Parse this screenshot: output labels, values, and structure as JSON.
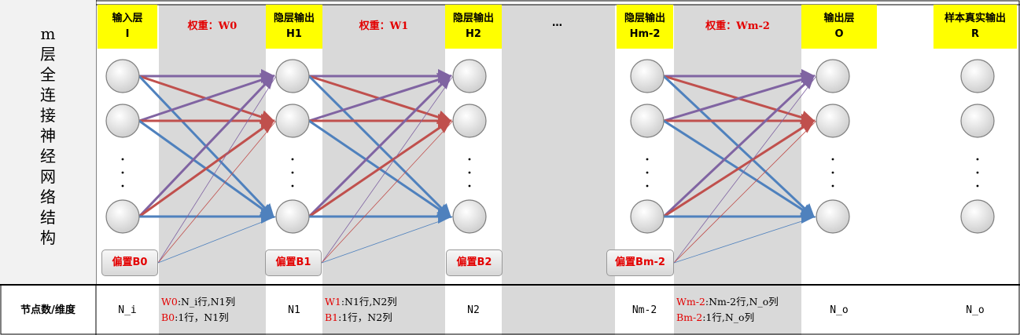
{
  "side_title": "m层全连接神经网络结构",
  "headers": [
    {
      "id": "input",
      "line1": "输入层",
      "line2": "I"
    },
    {
      "id": "h1",
      "line1": "隐层输出",
      "line2": "H1"
    },
    {
      "id": "h2",
      "line1": "隐层输出",
      "line2": "H2"
    },
    {
      "id": "hm2",
      "line1": "隐层输出",
      "line2": "Hm-2"
    },
    {
      "id": "output",
      "line1": "输出层",
      "line2": "O"
    },
    {
      "id": "real",
      "line1": "样本真实输出",
      "line2": "R"
    }
  ],
  "weights": [
    {
      "id": "w0",
      "label": "权重：W0"
    },
    {
      "id": "w1",
      "label": "权重：W1"
    },
    {
      "id": "wm2",
      "label": "权重：Wm-2"
    }
  ],
  "ellipsis": "…",
  "biases": [
    {
      "id": "b0",
      "label": "偏置B0"
    },
    {
      "id": "b1",
      "label": "偏置B1"
    },
    {
      "id": "b2",
      "label": "偏置B2"
    },
    {
      "id": "bm2",
      "label": "偏置Bm-2"
    }
  ],
  "bottom": {
    "row_label": "节点数/维度",
    "n_i": "N_i",
    "w0_line1_red": "W0",
    "w0_line1": ":N_i行,N1列",
    "w0_line2_red": "B0",
    "w0_line2": ":1行，N1列",
    "n1": "N1",
    "w1_line1_red": "W1",
    "w1_line1": ":N1行,N2列",
    "w1_line2_red": "B1",
    "w1_line2": ":1行，N2列",
    "n2": "N2",
    "nm2": "Nm-2",
    "wm2_line1_red": "Wm-2",
    "wm2_line1": ":Nm-2行,N_o列",
    "wm2_line2_red": "Bm-2",
    "wm2_line2": ":1行,N_o列",
    "n_o": "N_o",
    "n_o2": "N_o"
  },
  "colors": {
    "header_bg": "#ffff00",
    "weight_band": "#d9d9d9",
    "red_text": "#e30000",
    "arrow_purple": "#8064a2",
    "arrow_red": "#c0504d",
    "arrow_blue": "#4f81bd"
  }
}
